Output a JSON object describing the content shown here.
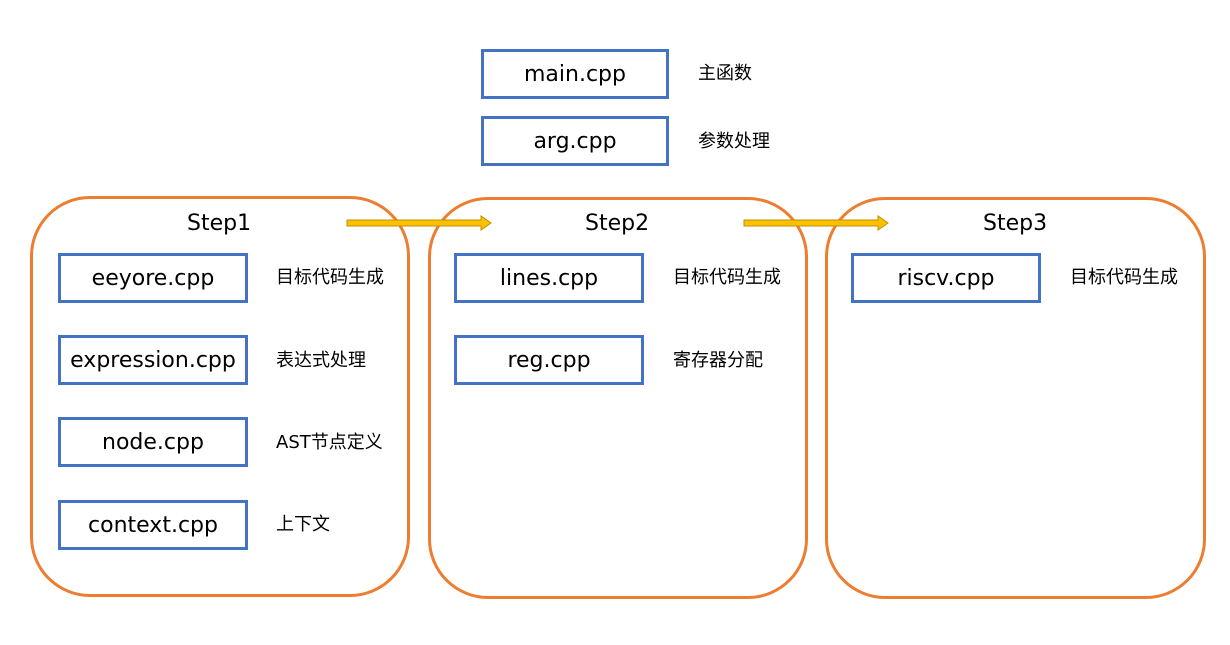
{
  "global_files": [
    {
      "file": "main.cpp",
      "desc": "主函数"
    },
    {
      "file": "arg.cpp",
      "desc": "参数处理"
    }
  ],
  "steps": [
    {
      "title": "Step1",
      "files": [
        {
          "file": "eeyore.cpp",
          "desc": "目标代码生成"
        },
        {
          "file": "expression.cpp",
          "desc": "表达式处理"
        },
        {
          "file": "node.cpp",
          "desc": "AST节点定义"
        },
        {
          "file": "context.cpp",
          "desc": "上下文"
        }
      ]
    },
    {
      "title": "Step2",
      "files": [
        {
          "file": "lines.cpp",
          "desc": "目标代码生成"
        },
        {
          "file": "reg.cpp",
          "desc": "寄存器分配"
        }
      ]
    },
    {
      "title": "Step3",
      "files": [
        {
          "file": "riscv.cpp",
          "desc": "目标代码生成"
        }
      ]
    }
  ],
  "colors": {
    "file_border": "#4472C4",
    "panel_border": "#ED7D31",
    "arrow_fill": "#FFC000",
    "arrow_stroke": "#BF9000"
  }
}
